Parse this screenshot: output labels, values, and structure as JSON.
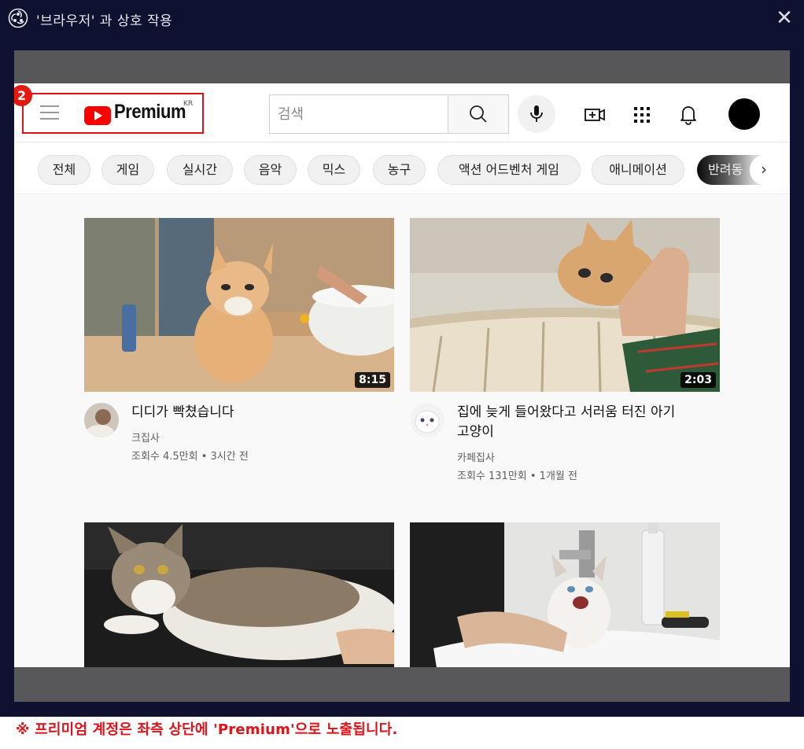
{
  "window": {
    "title": "'브라우저' 과 상호 작용",
    "close_symbol": "✕",
    "app_icon": "obs-icon"
  },
  "header": {
    "brand": "Premium",
    "region": "KR",
    "badge_number": "2",
    "search_placeholder": "검색",
    "icons": [
      "menu-icon",
      "youtube-logo-icon",
      "search-icon",
      "mic-icon",
      "create-video-icon",
      "apps-grid-icon",
      "bell-icon",
      "account-avatar"
    ]
  },
  "chips": {
    "items": [
      "전체",
      "게임",
      "실시간",
      "음악",
      "믹스",
      "농구",
      "액션 어드벤처 게임",
      "애니메이션"
    ],
    "partial": "반려동",
    "next_symbol": "›"
  },
  "videos": [
    {
      "title_lines": [
        "디디가 빡쳤습니다"
      ],
      "channel": "크집사",
      "meta": "조회수 4.5만회 • 3시간 전",
      "duration": "8:15"
    },
    {
      "title_lines": [
        "집에 늦게 들어왔다고 서러움 터진 아기",
        "고양이"
      ],
      "channel": "카페집사",
      "meta": "조회수 131만회 • 1개월 전",
      "duration": "2:03"
    },
    {
      "title_lines": [],
      "channel": "",
      "meta": "",
      "duration": ""
    },
    {
      "title_lines": [],
      "channel": "",
      "meta": "",
      "duration": ""
    }
  ],
  "caption": "※ 프리미엄 계정은 좌측 상단에 'Premium'으로 노출됩니다.",
  "colors": {
    "youtube_red": "#ff0000",
    "highlight_red": "#e20f1a",
    "titlebar": "#0e1130"
  }
}
